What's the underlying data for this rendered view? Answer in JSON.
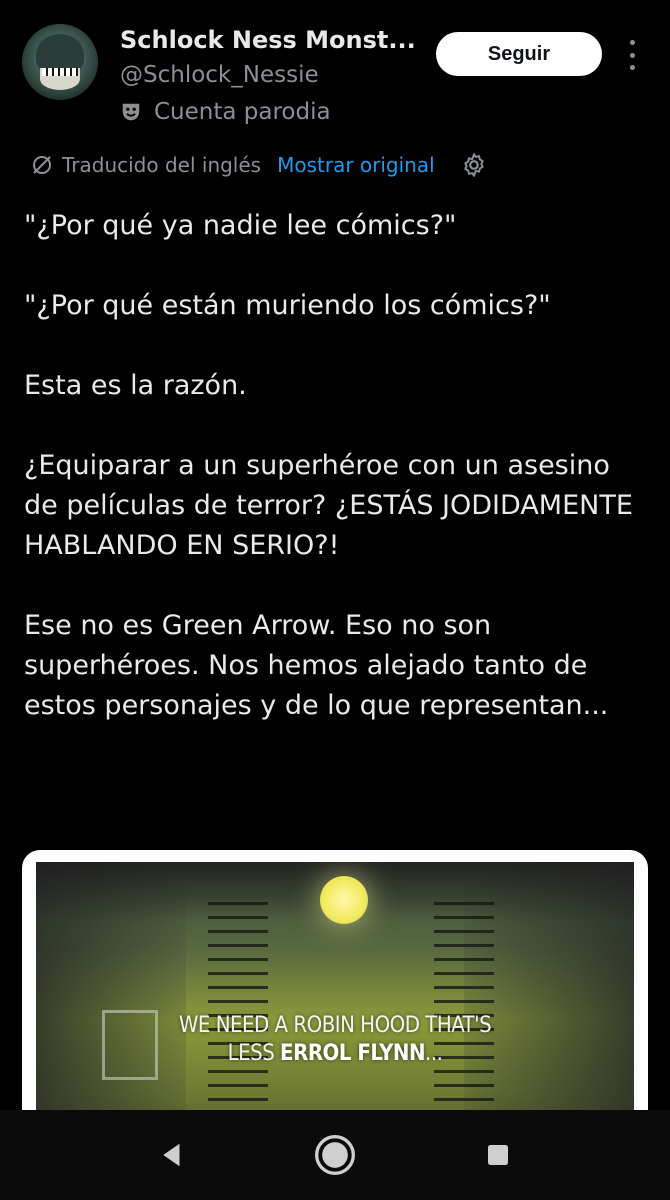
{
  "author": {
    "name": "Schlock Ness Monst...",
    "handle": "@Schlock_Nessie",
    "label": "Cuenta parodia",
    "label_icon": "theater-mask-icon"
  },
  "actions": {
    "follow_label": "Seguir",
    "more_icon": "more-vertical-icon"
  },
  "translation": {
    "label": "Traducido del inglés",
    "show_original": "Mostrar original",
    "icons": [
      "translate-icon",
      "gear-icon"
    ]
  },
  "tweet": {
    "paragraphs": [
      "\"¿Por qué ya nadie lee cómics?\"",
      "\"¿Por qué están muriendo los cómics?\"",
      "Esta es la razón.",
      "¿Equiparar a un superhéroe con un asesino de películas de terror? ¿ESTÁS JODIDAMENTE HABLANDO EN SERIO?!",
      "Ese no es Green Arrow. Eso no son superhéroes. Nos hemos alejado tanto de estos personajes y de lo que representan..."
    ]
  },
  "media": {
    "caption_line1": "WE NEED A ROBIN HOOD THAT'S",
    "caption_line2_prefix": "LESS ",
    "caption_line2_bold": "ERROL FLYNN",
    "caption_line2_suffix": "..."
  },
  "colors": {
    "background": "#000000",
    "text": "#e7e9ea",
    "muted": "#8b9096",
    "link": "#1d9bf0",
    "button_bg": "#ffffff"
  },
  "navbar": {
    "icons": [
      "back-icon",
      "home-icon",
      "recents-icon"
    ]
  }
}
